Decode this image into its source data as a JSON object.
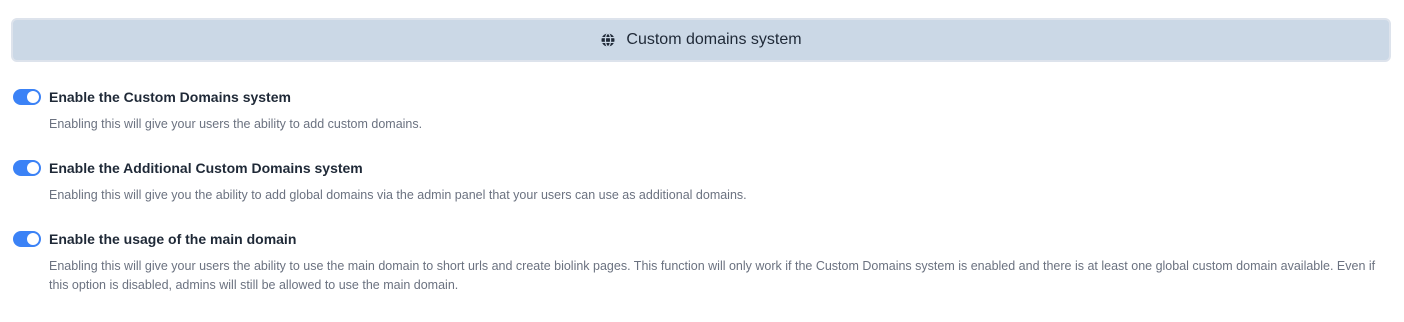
{
  "header": {
    "icon": "globe-icon",
    "title": "Custom domains system"
  },
  "accent_color": "#3b82f6",
  "options": [
    {
      "label": "Enable the Custom Domains system",
      "help": "Enabling this will give your users the ability to add custom domains.",
      "enabled": true
    },
    {
      "label": "Enable the Additional Custom Domains system",
      "help": "Enabling this will give you the ability to add global domains via the admin panel that your users can use as additional domains.",
      "enabled": true
    },
    {
      "label": "Enable the usage of the main domain",
      "help": "Enabling this will give your users the ability to use the main domain to short urls and create biolink pages. This function will only work if the Custom Domains system is enabled and there is at least one global custom domain available. Even if this option is disabled, admins will still be allowed to use the main domain.",
      "enabled": true
    }
  ]
}
